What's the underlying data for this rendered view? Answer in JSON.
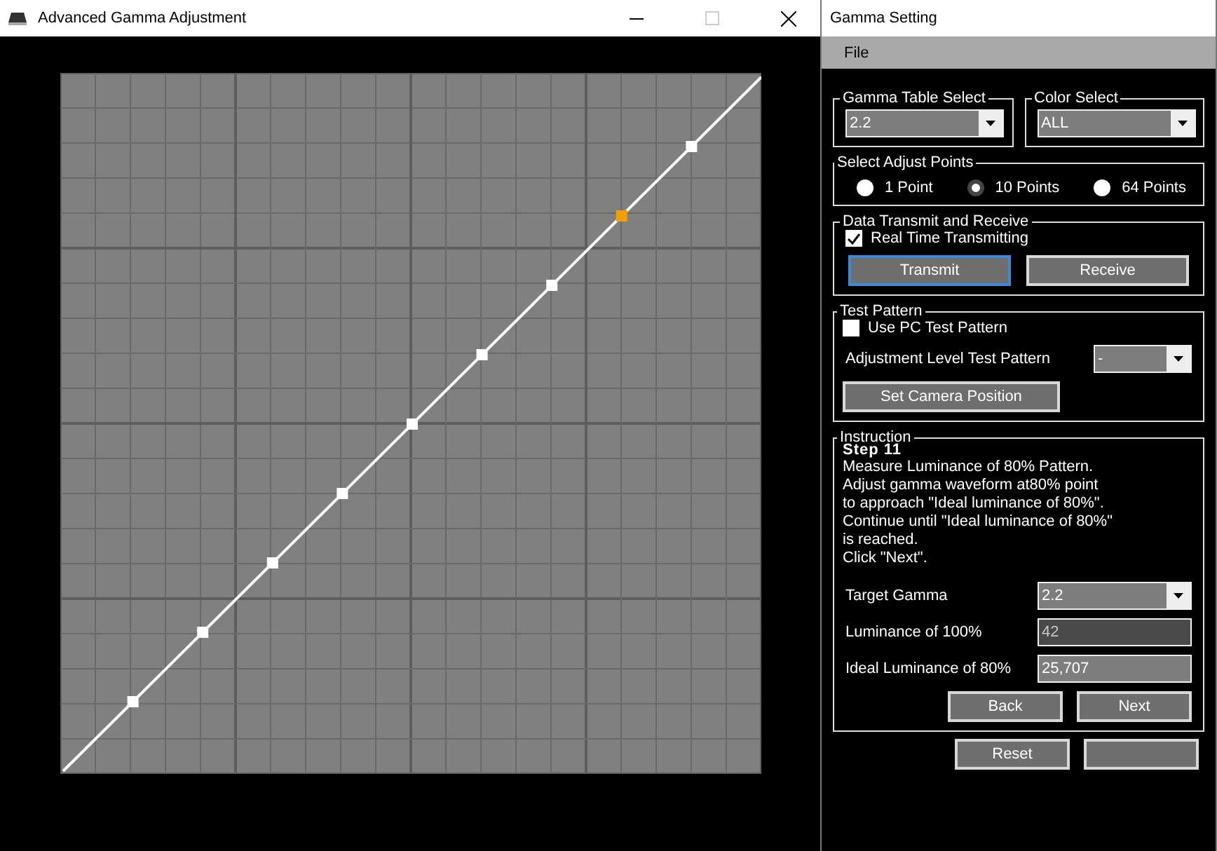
{
  "graph_window": {
    "title": "Advanced Gamma Adjustment",
    "points": [
      {
        "selected": false
      },
      {
        "selected": false
      },
      {
        "selected": false
      },
      {
        "selected": false
      },
      {
        "selected": false
      },
      {
        "selected": false
      },
      {
        "selected": false
      },
      {
        "selected": true
      },
      {
        "selected": false
      }
    ]
  },
  "settings_window": {
    "title": "Gamma Setting",
    "menu": [
      "File"
    ],
    "gamma_table": {
      "label": "Gamma Table Select",
      "value": "2.2"
    },
    "color_select": {
      "label": "Color Select",
      "value": "ALL"
    },
    "adjust_points": {
      "label": "Select Adjust Points",
      "options": [
        {
          "label": "1 Point",
          "selected": false
        },
        {
          "label": "10 Points",
          "selected": true
        },
        {
          "label": "64 Points",
          "selected": false
        }
      ]
    },
    "data_transmit": {
      "label": "Data Transmit and Receive",
      "realtime": {
        "label": "Real Time Transmitting",
        "checked": true
      },
      "buttons": [
        {
          "label": "Transmit",
          "focused": true
        },
        {
          "label": "Receive",
          "focused": false
        }
      ]
    },
    "test_pattern": {
      "label": "Test Pattern",
      "use_pc": {
        "label": "Use PC Test Pattern",
        "checked": false
      },
      "level_label": "Adjustment Level Test Pattern",
      "level_value": "-",
      "camera_button": "Set Camera Position"
    },
    "instruction": {
      "label": "Instruction",
      "step": "Step  11",
      "lines": [
        "Measure Luminance of 80% Pattern.",
        "Adjust gamma waveform at80% point",
        "to approach \"Ideal luminance of 80%\".",
        "Continue until \"Ideal luminance of 80%\"",
        "is reached.",
        "Click \"Next\"."
      ],
      "fields": [
        {
          "kind": "select",
          "label": "Target Gamma",
          "value": "2.2",
          "disabled": false
        },
        {
          "kind": "text",
          "label": "Luminance of 100%",
          "value": "42",
          "disabled": true
        },
        {
          "kind": "text",
          "label": "Ideal Luminance of 80%",
          "value": "25,707",
          "disabled": false
        }
      ],
      "nav_buttons": [
        "Back",
        "Next"
      ]
    },
    "footer_buttons": [
      "Reset"
    ]
  }
}
